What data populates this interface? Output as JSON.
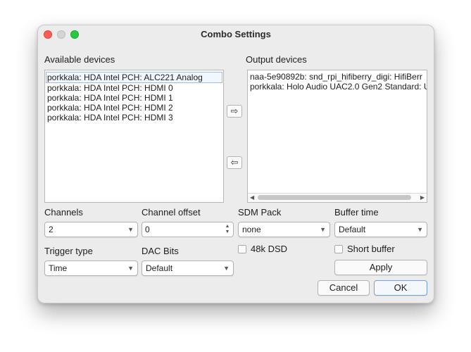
{
  "window": {
    "title": "Combo Settings"
  },
  "available": {
    "label": "Available devices",
    "items": [
      "porkkala: HDA Intel PCH: ALC221 Analog",
      "porkkala: HDA Intel PCH: HDMI 0",
      "porkkala: HDA Intel PCH: HDMI 1",
      "porkkala: HDA Intel PCH: HDMI 2",
      "porkkala: HDA Intel PCH: HDMI 3"
    ],
    "selected_index": 0
  },
  "output": {
    "label": "Output devices",
    "items": [
      "naa-5e90892b: snd_rpi_hifiberry_digi: HifiBerr",
      "porkkala: Holo Audio UAC2.0 Gen2 Standard: U"
    ]
  },
  "move_right_icon": "arrow-right-icon",
  "move_left_icon": "arrow-left-icon",
  "fields": {
    "channels": {
      "label": "Channels",
      "value": "2"
    },
    "channel_offset": {
      "label": "Channel offset",
      "value": "0"
    },
    "sdm_pack": {
      "label": "SDM Pack",
      "value": "none"
    },
    "buffer_time": {
      "label": "Buffer time",
      "value": "Default"
    },
    "trigger_type": {
      "label": "Trigger type",
      "value": "Time"
    },
    "dac_bits": {
      "label": "DAC Bits",
      "value": "Default"
    },
    "dsd48k": {
      "label": "48k DSD",
      "checked": false
    },
    "short_buffer": {
      "label": "Short buffer",
      "checked": false
    }
  },
  "buttons": {
    "apply": "Apply",
    "cancel": "Cancel",
    "ok": "OK"
  },
  "colors": {
    "close": "#fe5f57",
    "zoom": "#28c840",
    "accent": "#6fa3de"
  }
}
